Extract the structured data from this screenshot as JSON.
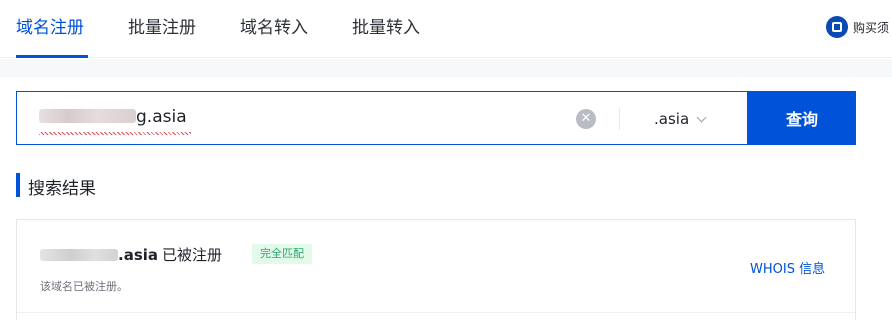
{
  "tabs": [
    {
      "label": "域名注册",
      "active": true
    },
    {
      "label": "批量注册",
      "active": false
    },
    {
      "label": "域名转入",
      "active": false
    },
    {
      "label": "批量转入",
      "active": false
    }
  ],
  "notice": {
    "label": "购买须",
    "icon": "document-icon"
  },
  "search": {
    "value_visible": "g.asia",
    "suffix": ".asia",
    "button_label": "查询"
  },
  "results": {
    "title": "搜索结果",
    "items": [
      {
        "domain_tld": ".asia",
        "status": "已被注册",
        "tag": "完全匹配",
        "description": "该域名已被注册。",
        "whois_label": "WHOIS 信息"
      }
    ]
  },
  "colors": {
    "accent": "#0052d9",
    "tag_green": "#2ba471",
    "tag_bg": "#e3f9e9"
  }
}
